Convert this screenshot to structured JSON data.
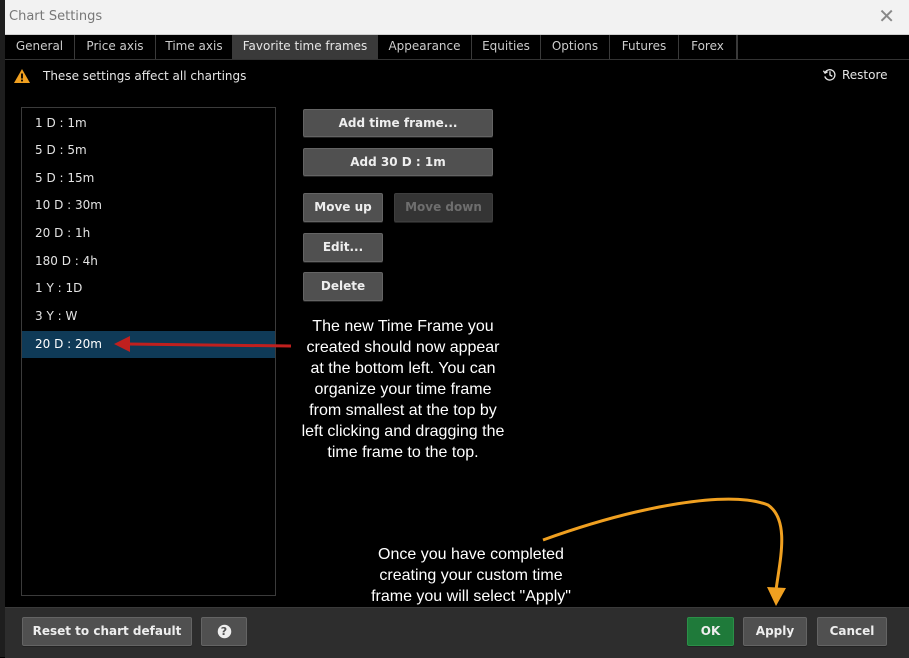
{
  "window": {
    "title": "Chart Settings",
    "close_symbol": "✕"
  },
  "tabs": [
    {
      "label": "General",
      "active": false
    },
    {
      "label": "Price axis",
      "active": false
    },
    {
      "label": "Time axis",
      "active": false
    },
    {
      "label": "Favorite time frames",
      "active": true
    },
    {
      "label": "Appearance",
      "active": false
    },
    {
      "label": "Equities",
      "active": false
    },
    {
      "label": "Options",
      "active": false
    },
    {
      "label": "Futures",
      "active": false
    },
    {
      "label": "Forex",
      "active": false
    }
  ],
  "notice": {
    "text": "These settings affect all chartings",
    "icon": "warning-icon",
    "icon_color": "#f0a020"
  },
  "restore": {
    "label": "Restore",
    "icon": "history-icon"
  },
  "time_frames": [
    {
      "label": "1 D : 1m",
      "selected": false
    },
    {
      "label": "5 D : 5m",
      "selected": false
    },
    {
      "label": "5 D : 15m",
      "selected": false
    },
    {
      "label": "10 D : 30m",
      "selected": false
    },
    {
      "label": "20 D : 1h",
      "selected": false
    },
    {
      "label": "180 D : 4h",
      "selected": false
    },
    {
      "label": "1 Y : 1D",
      "selected": false
    },
    {
      "label": "3 Y : W",
      "selected": false
    },
    {
      "label": "20 D : 20m",
      "selected": true
    }
  ],
  "actions": {
    "add_time_frame": "Add time frame...",
    "add_preset": "Add 30 D : 1m",
    "move_up": "Move up",
    "move_down": "Move down",
    "edit": "Edit...",
    "delete": "Delete"
  },
  "annotations": {
    "list_note": [
      "The new Time Frame you",
      "created should now appear",
      "at the bottom left. You can",
      "organize your time frame",
      "from smallest at the top by",
      "left clicking and dragging the",
      "time frame to the top."
    ],
    "apply_note": [
      "Once you have completed",
      "creating your custom time",
      "frame you will select \"Apply\""
    ],
    "list_arrow_color": "#c0201e",
    "apply_arrow_color": "#f0a020"
  },
  "footer": {
    "reset": "Reset to chart default",
    "help": "?",
    "ok": "OK",
    "apply": "Apply",
    "cancel": "Cancel"
  },
  "colors": {
    "selected_row": "#0f3a57",
    "ok_button": "#1f7a3a",
    "active_tab": "#3a3a3a"
  }
}
